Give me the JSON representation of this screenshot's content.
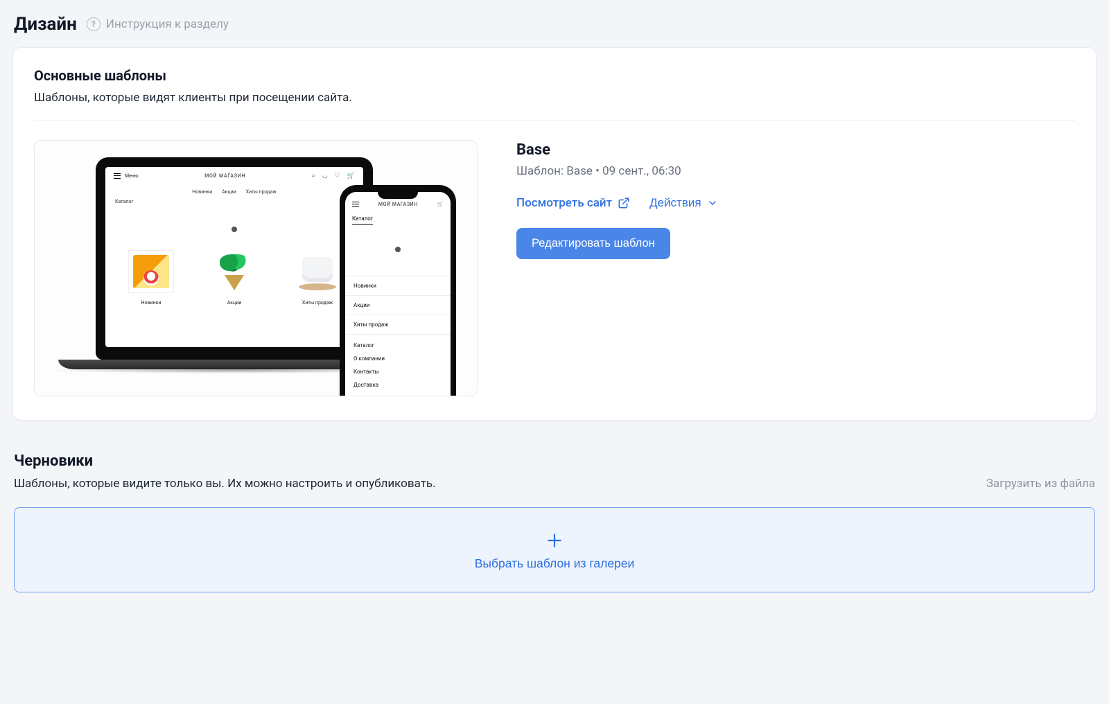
{
  "page": {
    "title": "Дизайн",
    "help_label": "Инструкция к разделу"
  },
  "main_templates": {
    "heading": "Основные шаблоны",
    "subtitle": "Шаблоны, которые видят клиенты при посещении сайта."
  },
  "template": {
    "name": "Base",
    "meta_line": "Шаблон: Base • 09 сент., 06:30",
    "view_site_label": "Посмотреть сайт",
    "actions_label": "Действия",
    "edit_button": "Редактировать шаблон"
  },
  "preview": {
    "laptop": {
      "menu_label": "Меню",
      "store_name": "МОЙ МАГАЗИН",
      "nav": [
        "Новинки",
        "Акции",
        "Хиты продаж"
      ],
      "sidebar_label": "Каталог",
      "product_labels": [
        "Новинки",
        "Акции",
        "Хиты продаж"
      ]
    },
    "phone": {
      "store_name": "МОЙ МАГАЗИН",
      "section_label": "Каталог",
      "list": [
        "Новинки",
        "Акции",
        "Хиты продаж"
      ],
      "footer": [
        "Каталог",
        "О компании",
        "Контакты",
        "Доставка"
      ]
    }
  },
  "drafts": {
    "heading": "Черновики",
    "subtitle": "Шаблоны, которые видите только вы. Их можно настроить и опубликовать.",
    "upload_label": "Загрузить из файла",
    "gallery_button": "Выбрать шаблон из галереи"
  }
}
